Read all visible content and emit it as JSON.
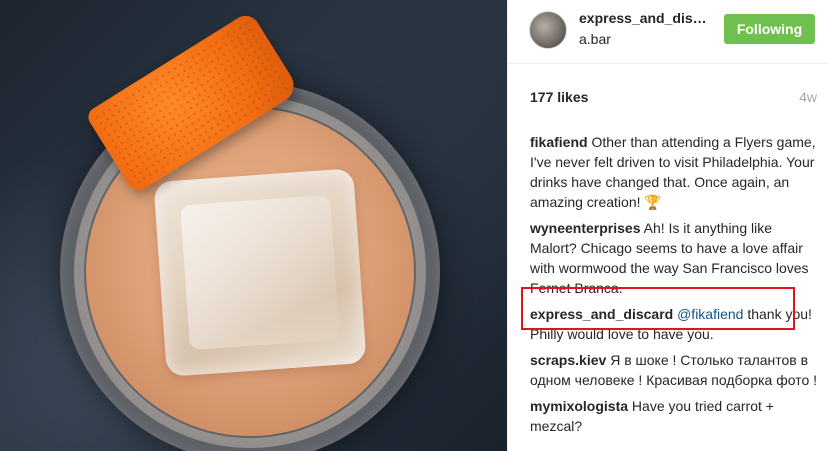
{
  "post": {
    "username": "express_and_dis…",
    "location": "a.bar",
    "follow_label": "Following",
    "likes": "177 likes",
    "age": "4w"
  },
  "comments": [
    {
      "user": "fikafiend",
      "text": "Other than attending a Flyers game, I've never felt driven to visit Philadelphia. Your drinks have changed that. Once again, an amazing creation! ",
      "icon": "🏆"
    },
    {
      "user": "wyneenterprises",
      "text": "Ah! Is it anything like Malort? Chicago seems to have a love affair with wormwood the way San Francisco loves Fernet Branca."
    },
    {
      "user": "express_and_discard",
      "mention": "@fikafiend",
      "text": "thank you! Philly would love to have you."
    },
    {
      "user": "scraps.kiev",
      "text": "Я в шоке ! Столько талантов в одном человеке ! Красивая подборка фото !"
    },
    {
      "user": "mymixologista",
      "text": "Have you tried carrot + mezcal?"
    }
  ],
  "colors": {
    "follow_button": "#70c050",
    "highlight": "#e0141e",
    "mention": "#125688"
  }
}
